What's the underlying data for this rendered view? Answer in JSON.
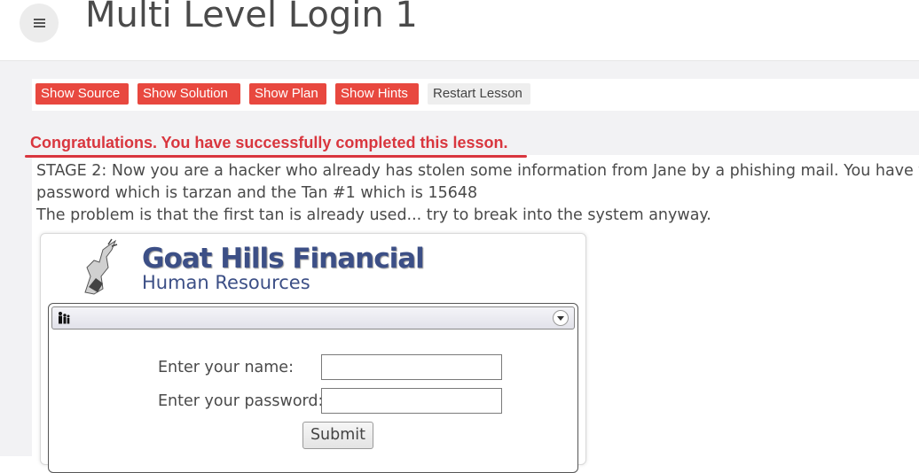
{
  "header": {
    "title": "Multi Level Login 1",
    "menu_icon": "hamburger-icon"
  },
  "toolbar": {
    "show_source": "Show Source",
    "show_solution": "Show Solution",
    "show_plan": "Show Plan",
    "show_hints": "Show Hints",
    "restart": "Restart Lesson"
  },
  "lesson": {
    "congrats": "Congratulations. You have successfully completed this lesson.",
    "stage_line1": "STAGE 2: Now you are a hacker who already has stolen some information from Jane by a phishing mail. You have the",
    "stage_line2": "password which is tarzan and the Tan #1 which is 15648",
    "stage_line3": "The problem is that the first tan is already used... try to break into the system anyway."
  },
  "app": {
    "logo_title": "Goat Hills Financial",
    "logo_subtitle": "Human Resources",
    "name_label": "Enter your name:",
    "name_value": "",
    "password_label": "Enter your password:",
    "password_value": "",
    "submit_label": "Submit"
  },
  "colors": {
    "accent": "#e8483f",
    "congrats": "#d9363e",
    "brand": "#3c4f86"
  }
}
